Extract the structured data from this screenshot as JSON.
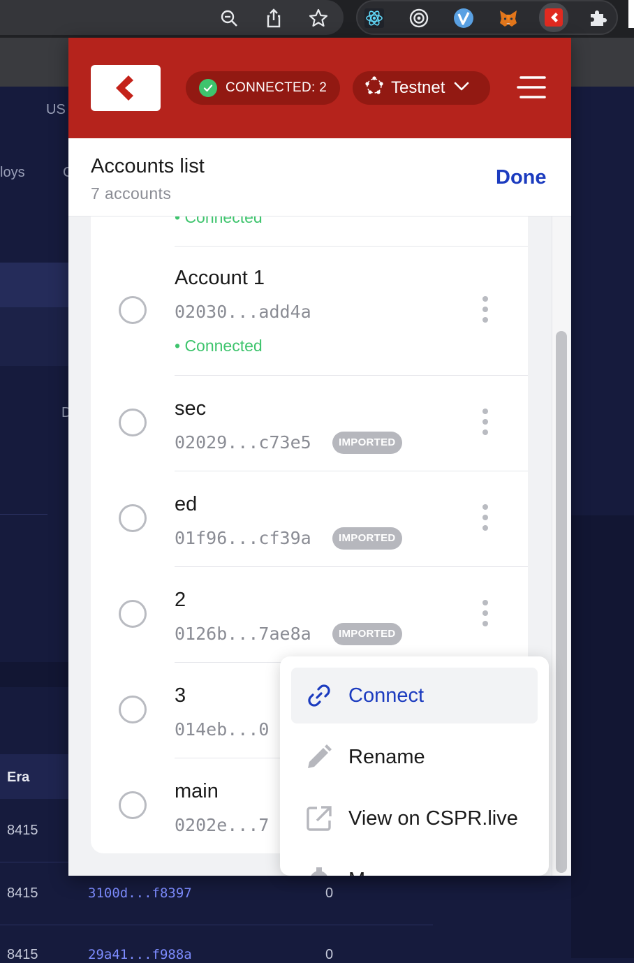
{
  "browser": {
    "extensions": [
      "zoom-out-icon",
      "share-icon",
      "bookmark-star-icon",
      "react-devtools-icon",
      "target-icon",
      "v-extension-icon",
      "metamask-fox-icon",
      "casper-signer-icon",
      "puzzle-icon"
    ]
  },
  "background": {
    "header_fragment": "US",
    "nav_fragment": "loys",
    "nav_fragment2": "C",
    "side_fragment": "D",
    "table": {
      "column_header": "Era",
      "rows": [
        {
          "era": "8415",
          "hash": "",
          "value": ""
        },
        {
          "era": "8415",
          "hash": "3100d...f8397",
          "value": "0"
        },
        {
          "era": "8415",
          "hash": "29a41...f988a",
          "value": "0"
        }
      ]
    }
  },
  "popup": {
    "connected_label": "CONNECTED: 2",
    "network_label": "Testnet",
    "list_title": "Accounts list",
    "list_count": "7 accounts",
    "done_label": "Done",
    "partial_status": "• Connected",
    "accounts": [
      {
        "name": "Account 1",
        "hash": "02030...add4a",
        "status": "• Connected",
        "badge": ""
      },
      {
        "name": "sec",
        "hash": "02029...c73e5",
        "status": "",
        "badge": "IMPORTED"
      },
      {
        "name": "ed",
        "hash": "01f96...cf39a",
        "status": "",
        "badge": "IMPORTED"
      },
      {
        "name": "2",
        "hash": "0126b...7ae8a",
        "status": "",
        "badge": "IMPORTED"
      },
      {
        "name": "3",
        "hash": "014eb...0",
        "status": "",
        "badge": ""
      },
      {
        "name": "main",
        "hash": "0202e...7",
        "status": "",
        "badge": ""
      }
    ],
    "context_menu": {
      "items": [
        {
          "label": "Connect",
          "icon": "link-icon",
          "active": true
        },
        {
          "label": "Rename",
          "icon": "pencil-icon",
          "active": false
        },
        {
          "label": "View on CSPR.live",
          "icon": "external-link-icon",
          "active": false
        },
        {
          "label": "M",
          "icon": "gear-icon",
          "active": false
        }
      ]
    }
  },
  "colors": {
    "header_red": "#b5231c",
    "pill_red": "#921912",
    "connected_green": "#3ec46d",
    "link_blue": "#1b3bbf"
  }
}
